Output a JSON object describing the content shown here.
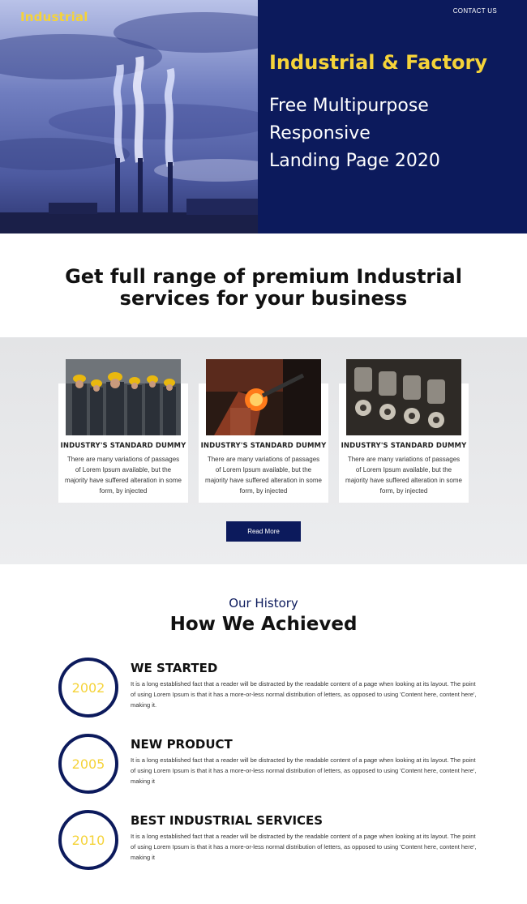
{
  "header": {
    "brand": "Industrial",
    "contact_link": "CONTACT US"
  },
  "hero": {
    "title": "Industrial & Factory",
    "subtitle_lines": [
      "Free Multipurpose",
      "Responsive",
      "Landing Page 2020"
    ]
  },
  "services": {
    "heading_lines": [
      "Get full range of premium Industrial",
      "services for your business"
    ],
    "cards": [
      {
        "title": "INDUSTRY'S STANDARD DUMMY",
        "text": "There are many variations of passages of Lorem Ipsum available, but the majority have suffered alteration in some form, by injected",
        "image": "workers-photo"
      },
      {
        "title": "INDUSTRY'S STANDARD DUMMY",
        "text": "There are many variations of passages of Lorem Ipsum available, but the majority have suffered alteration in some form, by injected",
        "image": "welding-photo"
      },
      {
        "title": "INDUSTRY'S STANDARD DUMMY",
        "text": "There are many variations of passages of Lorem Ipsum available, but the majority have suffered alteration in some form, by injected",
        "image": "engine-photo"
      }
    ],
    "read_more_label": "Read More"
  },
  "history": {
    "kicker": "Our History",
    "title": "How We Achieved",
    "items": [
      {
        "year": "2002",
        "heading": "WE STARTED",
        "text": "It is a long established fact that a reader will be distracted by the readable content of a page when looking at its layout. The point of using Lorem Ipsum is that it has a more-or-less normal distribution of letters, as opposed to using 'Content here, content here', making it."
      },
      {
        "year": "2005",
        "heading": "NEW PRODUCT",
        "text": "It is a long established fact that a reader will be distracted by the readable content of a page when looking at its layout. The point of using Lorem Ipsum is that it has a more-or-less normal distribution of letters, as opposed to using 'Content here, content here', making it"
      },
      {
        "year": "2010",
        "heading": "BEST INDUSTRIAL SERVICES",
        "text": "It is a long established fact that a reader will be distracted by the readable content of a page when looking at its layout. The point of using Lorem Ipsum is that it has a more-or-less normal distribution of letters, as opposed to using 'Content here, content here', making it"
      }
    ]
  },
  "colors": {
    "navy": "#0c1a5c",
    "yellow": "#f5d339",
    "band_gray": "#e6e7e9"
  }
}
